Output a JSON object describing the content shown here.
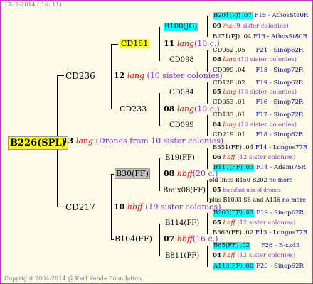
{
  "header": "17-  2-2014 ( 16: 11)",
  "footer": "Copyright 2004-2014 @ Karl Kehde Foundation.",
  "root": {
    "id": "B226(SPL)",
    "num": "13",
    "lang": "lang",
    "desc": "(Drones from 10 sister colonies)"
  },
  "gen1": {
    "top": {
      "id": "CD236",
      "num": "12",
      "lang": "lang",
      "desc": "(10 sister colonies)"
    },
    "bottom": {
      "id": "CD217",
      "num": "10",
      "lang": "hbff",
      "desc": "(19 sister colonies)"
    }
  },
  "gen2": {
    "a": {
      "id": "CD181",
      "num": "11",
      "lang": "lang",
      "desc": "(10 c.)"
    },
    "b": {
      "id": "CD233",
      "num": "08",
      "lang": "lang",
      "desc": "(10 c.)"
    },
    "c": {
      "id": "B30(FF)",
      "num": "08",
      "lang": "hbff",
      "desc": "(20 c.)"
    },
    "d": {
      "id": "B104(FF)",
      "num": "07",
      "lang": "hbff",
      "desc": "(16 c.)"
    }
  },
  "gen3": {
    "a1": {
      "id": "B100(JG)",
      "num": "09",
      "lang": "/ns",
      "desc": "(9 sister colonies)"
    },
    "a2": {
      "id": "CD098",
      "num": "08",
      "lang": "lang",
      "desc": "(10 sister colonies)"
    },
    "b1": {
      "id": "CD084",
      "num": "05",
      "lang": "lang",
      "desc": "(10 sister colonies)"
    },
    "b2": {
      "id": "CD099",
      "num": "04",
      "lang": "lang",
      "desc": "(10 sister colonies)"
    },
    "c1": {
      "id": "B19(FF)",
      "num": "06",
      "lang": "hbff",
      "desc": "(12 sister colonies)"
    },
    "c2": {
      "id": "Bmix08(FF)",
      "num": "05",
      "lang": "",
      "desc": "buckfast mix of drones"
    },
    "d1": {
      "id": "B114(FF)",
      "num": "05",
      "lang": "hbff",
      "desc": "(12 sister colonies)"
    },
    "d2": {
      "id": "B811(FF)",
      "num": "04",
      "lang": "hbff",
      "desc": "(12 sister colonies)"
    }
  },
  "gen4": [
    {
      "id": "B201(PJ)",
      "yr": ".07",
      "code": "F15 - AthosSt80R"
    },
    {
      "id": "B271(PJ)",
      "yr": ".04",
      "code": "F13 - AthosSt80R"
    },
    {
      "id": "CD052",
      "yr": ".05",
      "code": "F21 - Sinop62R"
    },
    {
      "id": "CD099",
      "yr": ".04",
      "code": "F18 - Sinop72R"
    },
    {
      "id": "CD128",
      "yr": ".02",
      "code": "F19 - Sinop62R"
    },
    {
      "id": "CD053",
      "yr": ".01",
      "code": "F16 - Sinop72R"
    },
    {
      "id": "CD133",
      "yr": ".01",
      "code": "F17 - Sinop72R"
    },
    {
      "id": "CD219",
      "yr": ".01",
      "code": "F18 - Sinop62R"
    },
    {
      "id": "B351(FF)",
      "yr": ".04",
      "code": "F14 - Longos77R"
    },
    {
      "id": "B117(FF)",
      "yr": ".03",
      "code": "F14 - Adami75R"
    },
    {
      "id": "old lines B150 B202",
      "yr": "",
      "code": "no more"
    },
    {
      "id": "plus B1003 S6 and A136",
      "yr": "",
      "code": "no more"
    },
    {
      "id": "B203(FF)",
      "yr": ".03",
      "code": "F19 - Sinop62R"
    },
    {
      "id": "B363(FF)",
      "yr": ".02",
      "code": "F13 - Longos77R"
    },
    {
      "id": "B65(FF)",
      "yr": ".02",
      "code": "F26 - B-xx43"
    },
    {
      "id": "A113(FF)",
      "yr": ".00",
      "code": "F20 - Sinop62R"
    }
  ]
}
